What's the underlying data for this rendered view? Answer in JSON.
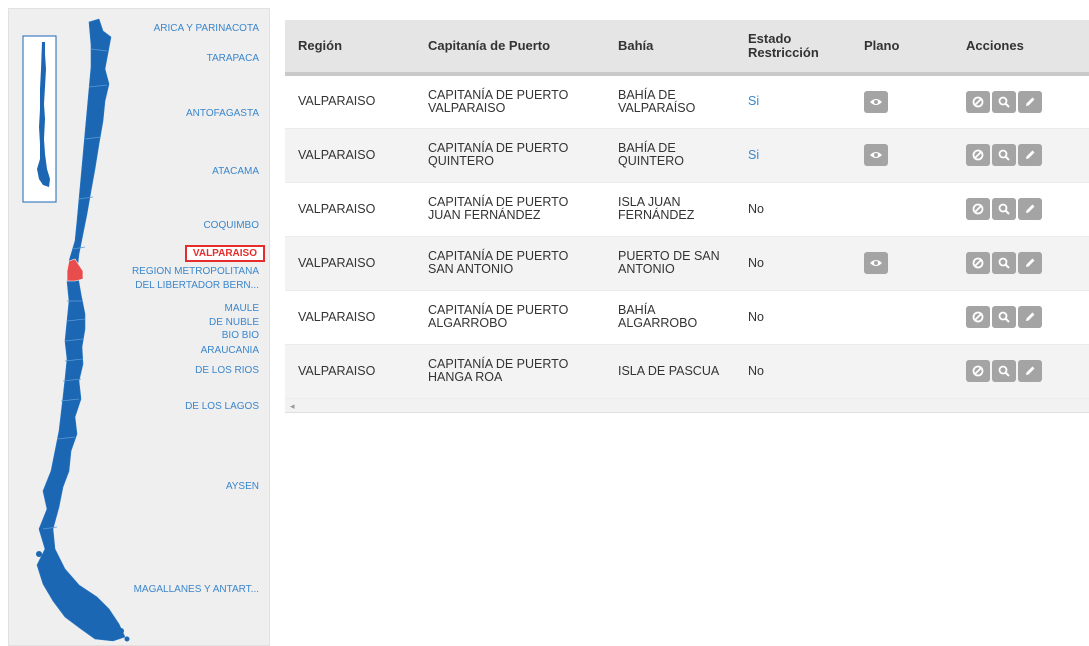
{
  "map": {
    "regions": [
      {
        "label": "ARICA Y PARINACOTA",
        "active": false
      },
      {
        "label": "TARAPACA",
        "active": false
      },
      {
        "label": "ANTOFAGASTA",
        "active": false
      },
      {
        "label": "ATACAMA",
        "active": false
      },
      {
        "label": "COQUIMBO",
        "active": false
      },
      {
        "label": "VALPARAISO",
        "active": true
      },
      {
        "label": "REGION METROPOLITANA",
        "active": false
      },
      {
        "label": "DEL LIBERTADOR BERN...",
        "active": false
      },
      {
        "label": "MAULE",
        "active": false
      },
      {
        "label": "DE NUBLE",
        "active": false
      },
      {
        "label": "BIO BIO",
        "active": false
      },
      {
        "label": "ARAUCANIA",
        "active": false
      },
      {
        "label": "DE LOS RIOS",
        "active": false
      },
      {
        "label": "DE LOS LAGOS",
        "active": false
      },
      {
        "label": "AYSEN",
        "active": false
      },
      {
        "label": "MAGALLANES Y ANTART...",
        "active": false
      }
    ],
    "colors": {
      "region_fill": "#1c67b4",
      "selected_fill": "#e84c4c",
      "link": "#3a86cc"
    }
  },
  "table": {
    "headers": {
      "region": "Región",
      "capitania": "Capitanía de Puerto",
      "bahia": "Bahía",
      "estado": "Estado Restricción",
      "plano": "Plano",
      "acciones": "Acciones"
    },
    "rows": [
      {
        "region": "VALPARAISO",
        "capitania": "CAPITANÍA DE PUERTO VALPARAISO",
        "bahia": "BAHÍA DE VALPARAÍSO",
        "estado": "Si",
        "plano": true
      },
      {
        "region": "VALPARAISO",
        "capitania": "CAPITANÍA DE PUERTO QUINTERO",
        "bahia": "BAHÍA DE QUINTERO",
        "estado": "Si",
        "plano": true
      },
      {
        "region": "VALPARAISO",
        "capitania": "CAPITANÍA DE PUERTO JUAN FERNÁNDEZ",
        "bahia": "ISLA JUAN FERNÁNDEZ",
        "estado": "No",
        "plano": false
      },
      {
        "region": "VALPARAISO",
        "capitania": "CAPITANÍA DE PUERTO SAN ANTONIO",
        "bahia": "PUERTO DE SAN ANTONIO",
        "estado": "No",
        "plano": true
      },
      {
        "region": "VALPARAISO",
        "capitania": "CAPITANÍA DE PUERTO ALGARROBO",
        "bahia": "BAHÍA ALGARROBO",
        "estado": "No",
        "plano": false
      },
      {
        "region": "VALPARAISO",
        "capitania": "CAPITANÍA DE PUERTO HANGA ROA",
        "bahia": "ISLA DE PASCUA",
        "estado": "No",
        "plano": false
      }
    ],
    "action_icons": [
      "block-icon",
      "search-icon",
      "edit-icon"
    ],
    "plano_icon": "eye-icon",
    "scroll_arrow": "◂"
  }
}
